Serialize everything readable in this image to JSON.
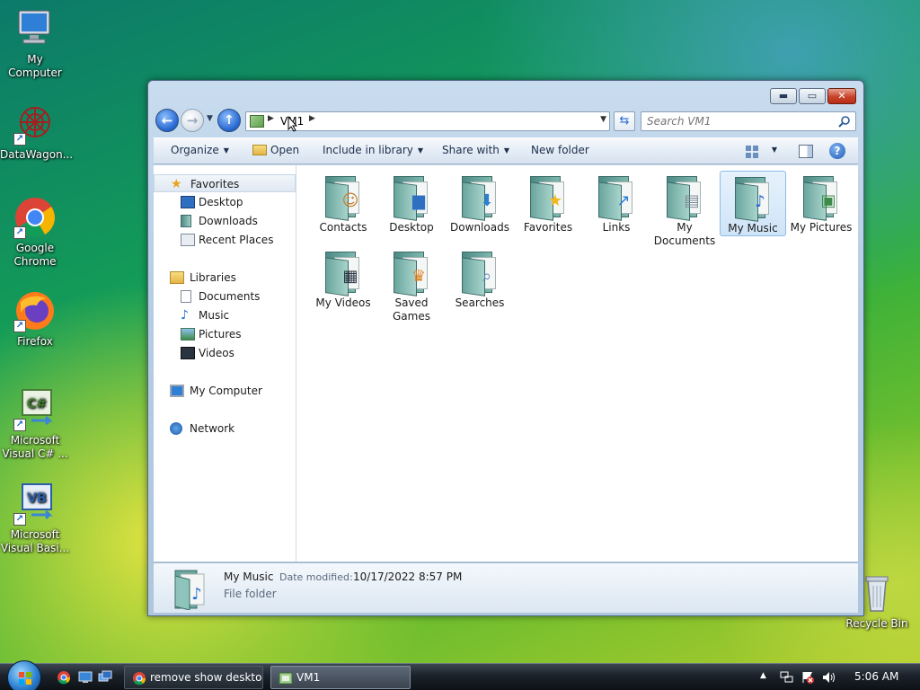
{
  "desktop": {
    "icons": [
      {
        "label": "My Computer"
      },
      {
        "label": "DataWagon..."
      },
      {
        "label": "Google\nChrome"
      },
      {
        "label": "Firefox"
      },
      {
        "label": "Microsoft\nVisual C# ..."
      },
      {
        "label": "Microsoft\nVisual Basi..."
      },
      {
        "label": "Recycle Bin"
      }
    ]
  },
  "window": {
    "address": {
      "segment": "VM1"
    },
    "search": {
      "placeholder": "Search VM1"
    },
    "toolbar": {
      "organize": "Organize",
      "open": "Open",
      "include_in_library": "Include in library",
      "share_with": "Share with",
      "new_folder": "New folder"
    },
    "navpane": {
      "favorites": "Favorites",
      "desktop": "Desktop",
      "downloads": "Downloads",
      "recent_places": "Recent Places",
      "libraries": "Libraries",
      "documents": "Documents",
      "music": "Music",
      "pictures": "Pictures",
      "videos": "Videos",
      "my_computer": "My Computer",
      "network": "Network"
    },
    "folders": [
      {
        "label": "Contacts"
      },
      {
        "label": "Desktop"
      },
      {
        "label": "Downloads"
      },
      {
        "label": "Favorites"
      },
      {
        "label": "Links"
      },
      {
        "label": "My Documents"
      },
      {
        "label": "My Music"
      },
      {
        "label": "My Pictures"
      },
      {
        "label": "My Videos"
      },
      {
        "label": "Saved Games"
      },
      {
        "label": "Searches"
      }
    ],
    "details": {
      "name": "My Music",
      "modified_label": "Date modified:",
      "modified_value": "10/17/2022 8:57 PM",
      "type": "File folder"
    }
  },
  "taskbar": {
    "tasks": [
      {
        "label": "remove show deskto..."
      },
      {
        "label": "VM1"
      }
    ],
    "clock": "5:06 AM"
  },
  "colors": {
    "window_frame": "#b6cde4",
    "selection": "#cfe4f8",
    "taskbar": "#1a2129"
  }
}
